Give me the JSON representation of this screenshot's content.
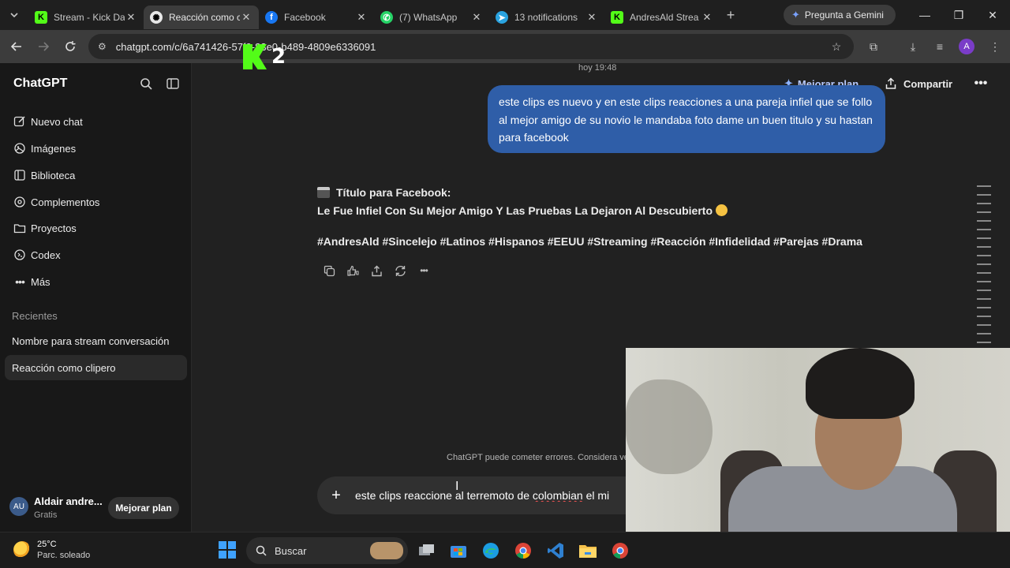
{
  "browser": {
    "tabs": [
      {
        "label": "Stream - Kick Da",
        "favicon": "kick-icon",
        "color": "#53fc18",
        "active": false
      },
      {
        "label": "Reacción como c",
        "favicon": "chatgpt-icon",
        "color": "#ffffff",
        "active": true
      },
      {
        "label": "Facebook",
        "favicon": "facebook-icon",
        "color": "#1877f2",
        "active": false
      },
      {
        "label": "(7) WhatsApp",
        "favicon": "whatsapp-icon",
        "color": "#25d366",
        "active": false
      },
      {
        "label": "13 notifications",
        "favicon": "telegram-icon",
        "color": "#2aa3e0",
        "active": false
      },
      {
        "label": "AndresAld Strea",
        "favicon": "kick-icon",
        "color": "#53fc18",
        "active": false
      }
    ],
    "gemini_label": "Pregunta a Gemini",
    "url": "chatgpt.com/c/6a741426-57f0-83e0-b489-4809e6336091",
    "profile_initial": "A"
  },
  "overlay": {
    "kick_number": "2"
  },
  "sidebar": {
    "brand": "ChatGPT",
    "items": [
      {
        "label": "Nuevo chat",
        "icon": "edit-icon"
      },
      {
        "label": "Imágenes",
        "icon": "images-icon"
      },
      {
        "label": "Biblioteca",
        "icon": "library-icon"
      },
      {
        "label": "Complementos",
        "icon": "apps-icon"
      },
      {
        "label": "Proyectos",
        "icon": "folder-icon"
      },
      {
        "label": "Codex",
        "icon": "codex-icon"
      },
      {
        "label": "Más",
        "icon": "more-icon"
      }
    ],
    "recents_heading": "Recientes",
    "recents": [
      {
        "label": "Nombre para stream conversación",
        "active": false
      },
      {
        "label": "Reacción como clipero",
        "active": true
      }
    ],
    "user": {
      "initials": "AU",
      "name": "Aldair andre...",
      "plan": "Gratis",
      "upgrade_label": "Mejorar plan"
    }
  },
  "header": {
    "timestamp": "hoy 19:48",
    "upgrade_label": "Mejorar plan",
    "share_label": "Compartir"
  },
  "conversation": {
    "user_message": "este clips es nuevo y  en este clips reacciones a una pareja infiel que se follo al mejor amigo de su novio le mandaba foto dame un buen titulo y su hastan para facebook",
    "assistant": {
      "title": "Título para Facebook:",
      "headline": "Le Fue Infiel Con Su Mejor Amigo Y Las Pruebas La Dejaron Al Descubierto",
      "hashtags": "#AndresAld #Sincelejo #Latinos #Hispanos #EEUU #Streaming #Reacción #Infidelidad #Parejas #Drama"
    }
  },
  "disclaimer": "ChatGPT puede cometer errores. Considera ve",
  "composer": {
    "text_before": "este clips reaccione al terremoto de ",
    "text_misspelled": "colombian",
    "text_after": " el mi"
  },
  "taskbar": {
    "temperature": "25°C",
    "condition": "Parc. soleado",
    "search_label": "Buscar"
  }
}
